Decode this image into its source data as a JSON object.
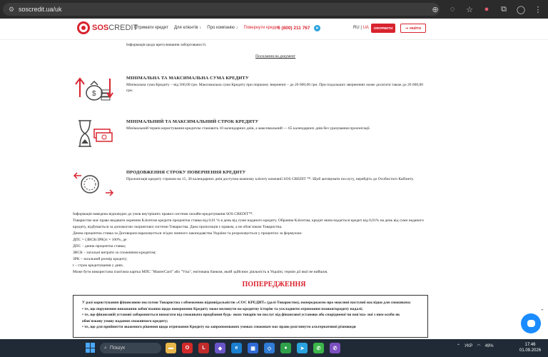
{
  "browser": {
    "url": "soscredit.ua/uk"
  },
  "header": {
    "logo_sos": "SOS",
    "logo_credit": "CREDIT",
    "nav": [
      {
        "label": "Отримати кредит"
      },
      {
        "label": "Для клієнтів ↓"
      },
      {
        "label": "Про компанію ↓"
      },
      {
        "label": "Повернути кредит"
      }
    ],
    "phone": "0 (800) 211 767",
    "lang_ru": "RU",
    "lang_sep": "|",
    "lang_ua": "UA",
    "apply_label": "ОФОРМИТИ",
    "login_label": "УВІЙТИ"
  },
  "content": {
    "top_text": "Інформація щодо врегулювання заборгованості.",
    "top_link": "Посилання на документ",
    "features": [
      {
        "title": "МІНІМАЛЬНА ТА МАКСИМАЛЬНА СУМА КРЕДИТУ",
        "text": "Мінімальна сума Кредиту – від 500,00 грн. Максимальна сума Кредиту при першому зверненні – до 20 000,00 грн. При подальших зверненнях може досягати також до 20 000,00 грн."
      },
      {
        "title": "МІНІМАЛЬНИЙ ТА МАКСИМАЛЬНИЙ СТРОК КРЕДИТУ",
        "text": "Мінімальний термін користування кредитом становить 10 календарних днів, а максимальний — 65 календарних днів без урахування пролонгації."
      },
      {
        "title": "ПРОДОВЖЕННЯ СТРОКУ ПОВЕРНЕННЯ КРЕДИТУ",
        "text": "Пролонгація кредиту строком на 15, 30 календарних днів доступна кожному клієнту компанії SOS CREDIT ™. Щоб активувати послугу, перейдіть до Особистого Кабінету."
      }
    ],
    "info_lines": [
      "Інформація наведена відповідно до умов внутрішніх правил системи онлайн-кредитування SOS CREDIT™.",
      "Товариство має право видавати окремим Клієнтам кредити процентна ставка від 0,01 % в день від суми наданого кредиту. Обраним Клієнтам, кредит яким надається кредит від 0,01% на день від суми наданого кредиту, відбувається за допомогою скоринговоі системи Товариства. Дана пропозиція є правом, а не обов`язком Товариства.",
      "Денна процентна ставка за Договором нараховується згідно чинного законодавства України та розраховується у процентах за формулою:",
      "ДПС = (ЗВСК/ЗРК)/t × 100%, де",
      "ДПС – денна процентна ставка;",
      "ЗВСК – загальні витрати за споживчим кредитом;",
      "ЗРК – загальний розмір кредиту;",
      "t – строк кредитування у днях.",
      "Може бути використана платіжна картка МПС \"MasterCard\" або \"Visa\", емітована банком, який здійснює діяльність в Україні, термін дії якої не вийшов."
    ],
    "warning_title": "ПОПЕРЕДЖЕННЯ",
    "warning_lines": [
      "У разі користування фінансовою послугою Товариства з обмеженою відповідальністю «СОС КРЕДИТ» (далі-Товариство), попереджаємо про можливі наступні наслідки для споживача:",
      "• те, що порушення виконання зобов'язання щодо повернення Кредиту може вплинути на кредитну історію та ускладнити отримання позики/кредиту надалі;",
      "• те, що фінансовій установі забороняється вимагати від споживача придбання будь- яких товарів чи послуг від фінансової установи або спорідненої чи пов'яза- ної з ним особи як обов'язкову умову надання споживчого кредиту;",
      "• те, що для прийняття зваженого рішення щодо отримання Кредиту на запропонованих умовах споживач має право розглянути альтернативні різновиди"
    ]
  },
  "taskbar": {
    "search_label": "Пошук",
    "lang": "УКР",
    "battery": "49%",
    "time": "17:46",
    "date": "01.09.2026"
  },
  "colors": {
    "brand_red": "#d9232e",
    "chat_blue": "#1a8cff",
    "taskbar": "#1f2a36"
  }
}
